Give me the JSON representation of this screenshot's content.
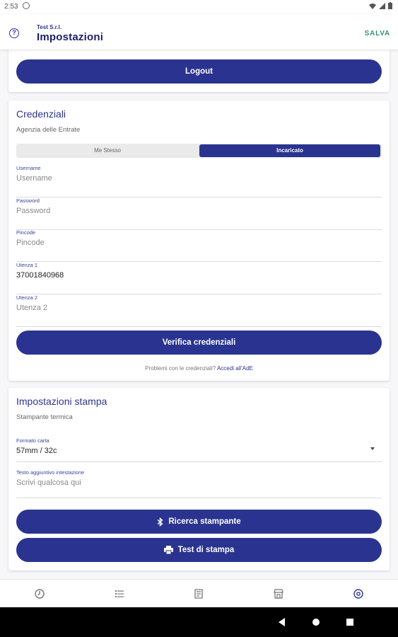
{
  "status_bar": {
    "time": "2:53",
    "icons": [
      "wifi-icon",
      "signal-icon",
      "battery-icon"
    ]
  },
  "app_bar": {
    "company": "Test S.r.l.",
    "title": "Impostazioni",
    "save_label": "SALVA",
    "help_icon": "help-circle-icon"
  },
  "account": {
    "logout_label": "Logout"
  },
  "credentials": {
    "title": "Credenziali",
    "subtitle": "Agenzia delle Entrate",
    "segment": {
      "left_label": "Me Stesso",
      "right_label": "Incaricato",
      "selected": "Incaricato"
    },
    "fields": [
      {
        "label": "Username",
        "value": "",
        "placeholder": "Username"
      },
      {
        "label": "Password",
        "value": "",
        "placeholder": "Password"
      },
      {
        "label": "Pincode",
        "value": "",
        "placeholder": "Pincode"
      },
      {
        "label": "Utenza 1",
        "value": "37001840968",
        "placeholder": ""
      },
      {
        "label": "Utenza 2",
        "value": "",
        "placeholder": "Utenza 2"
      }
    ],
    "verify_label": "Verifica credenziali",
    "problems_text": "Problemi con le credenziali?",
    "problems_link": "Accedi all'AdE"
  },
  "print_settings": {
    "title": "Impostazioni stampa",
    "subtitle": "Stampante termica",
    "paper_format": {
      "label": "Formato carta",
      "value": "57mm / 32c"
    },
    "header_text": {
      "label": "Testo aggiuntivo intestazione",
      "placeholder": "Scrivi qualcosa qui"
    },
    "search_printer_label": "Ricerca stampante",
    "test_print_label": "Test di stampa"
  },
  "bottom_nav": [
    "history-icon",
    "list-icon",
    "receipt-icon",
    "store-icon",
    "settings-icon"
  ],
  "colors": {
    "primary": "#2a3490",
    "accent_text": "#2c3590",
    "save": "#3a8f7a"
  }
}
